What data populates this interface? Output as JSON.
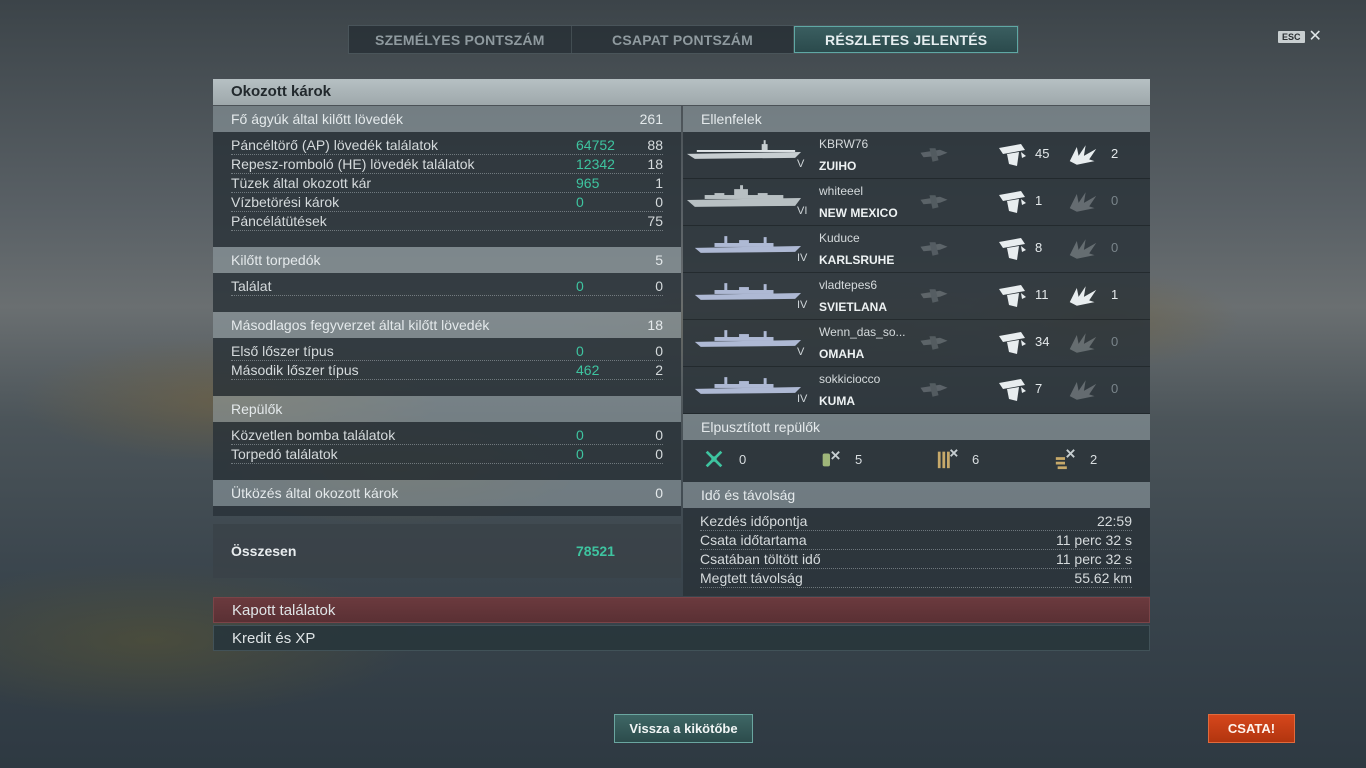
{
  "tabs": [
    {
      "label": "SZEMÉLYES PONTSZÁM",
      "active": false
    },
    {
      "label": "CSAPAT PONTSZÁM",
      "active": false
    },
    {
      "label": "RÉSZLETES JELENTÉS",
      "active": true
    }
  ],
  "esc_label": "ESC",
  "close_glyph": "✕",
  "panel_title": "Okozott károk",
  "main_guns": {
    "label": "Fő ágyúk által kilőtt lövedék",
    "value": "261",
    "rows": [
      {
        "label": "Páncéltörő (AP) lövedék találatok",
        "damage": "64752",
        "count": "88"
      },
      {
        "label": "Repesz-romboló (HE) lövedék találatok",
        "damage": "12342",
        "count": "18"
      },
      {
        "label": "Tüzek által okozott kár",
        "damage": "965",
        "count": "1"
      },
      {
        "label": "Vízbetörési károk",
        "damage": "0",
        "count": "0"
      },
      {
        "label": "Páncélátütések",
        "damage": "",
        "count": "75"
      }
    ]
  },
  "torpedoes": {
    "label": "Kilőtt torpedók",
    "value": "5",
    "rows": [
      {
        "label": "Találat",
        "damage": "0",
        "count": "0"
      }
    ]
  },
  "secondary": {
    "label": "Másodlagos fegyverzet által kilőtt lövedék",
    "value": "18",
    "rows": [
      {
        "label": "Első lőszer típus",
        "damage": "0",
        "count": "0"
      },
      {
        "label": "Második lőszer típus",
        "damage": "462",
        "count": "2"
      }
    ]
  },
  "aircraft": {
    "label": "Repülők",
    "rows": [
      {
        "label": "Közvetlen bomba találatok",
        "damage": "0",
        "count": "0"
      },
      {
        "label": "Torpedó találatok",
        "damage": "0",
        "count": "0"
      }
    ]
  },
  "ramming": {
    "label": "Ütközés által okozott károk",
    "value": "0"
  },
  "total": {
    "label": "Összesen",
    "value": "78521"
  },
  "enemies": {
    "label": "Ellenfelek",
    "list": [
      {
        "player": "KBRW76",
        "ship": "ZUIHO",
        "tier": "V",
        "hits": "45",
        "hits_active": true,
        "crit": "2",
        "crit_active": true,
        "type": "carrier"
      },
      {
        "player": "whiteeel",
        "ship": "NEW MEXICO",
        "tier": "VI",
        "hits": "1",
        "hits_active": true,
        "crit": "0",
        "crit_active": false,
        "type": "battleship"
      },
      {
        "player": "Kuduce",
        "ship": "KARLSRUHE",
        "tier": "IV",
        "hits": "8",
        "hits_active": true,
        "crit": "0",
        "crit_active": false,
        "type": "cruiser"
      },
      {
        "player": "vladtepes6",
        "ship": "SVIETLANA",
        "tier": "IV",
        "hits": "11",
        "hits_active": true,
        "crit": "1",
        "crit_active": true,
        "type": "cruiser"
      },
      {
        "player": "Wenn_das_so...",
        "ship": "OMAHA",
        "tier": "V",
        "hits": "34",
        "hits_active": true,
        "crit": "0",
        "crit_active": false,
        "type": "cruiser"
      },
      {
        "player": "sokkiciocco",
        "ship": "KUMA",
        "tier": "IV",
        "hits": "7",
        "hits_active": true,
        "crit": "0",
        "crit_active": false,
        "type": "cruiser"
      }
    ]
  },
  "planes_destroyed": {
    "label": "Elpusztított repülők",
    "items": [
      {
        "icon": "fighter-plane-icon",
        "value": "0"
      },
      {
        "icon": "torpedo-bomber-icon",
        "value": "5"
      },
      {
        "icon": "dive-bomber-icon",
        "value": "6"
      },
      {
        "icon": "scout-plane-icon",
        "value": "2"
      }
    ]
  },
  "time": {
    "label": "Idő és távolság",
    "rows": [
      {
        "label": "Kezdés időpontja",
        "value": "22:59"
      },
      {
        "label": "Csata időtartama",
        "value": "11 perc 32 s"
      },
      {
        "label": "Csatában töltött idő",
        "value": "11 perc 32 s"
      },
      {
        "label": "Megtett távolság",
        "value": "55.62 km"
      }
    ]
  },
  "received_hits": "Kapott találatok",
  "credits_xp": "Kredit és XP",
  "back_to_port": "Vissza a kikötőbe",
  "battle": "CSATA!",
  "colors": {
    "accent_green": "#3ec4a0",
    "battle_orange": "#c93e14",
    "received_red": "#6b3a3e"
  }
}
